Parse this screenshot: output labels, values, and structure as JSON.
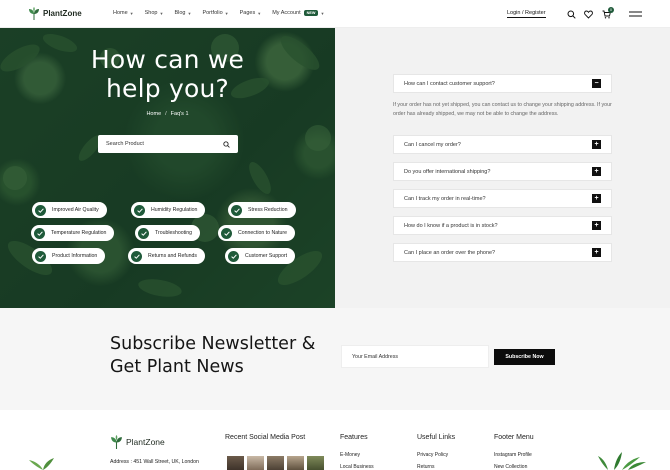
{
  "header": {
    "brand": "PlantZone",
    "nav": [
      {
        "label": "Home"
      },
      {
        "label": "Shop"
      },
      {
        "label": "Blog"
      },
      {
        "label": "Portfolio"
      },
      {
        "label": "Pages"
      },
      {
        "label": "My Account",
        "badge": "NEW"
      }
    ],
    "login_label": "Login / Register",
    "cart_count": "0",
    "icons": [
      "search-icon",
      "heart-icon",
      "cart-icon",
      "menu-icon"
    ]
  },
  "hero": {
    "title_line1": "How can we",
    "title_line2": "help you?",
    "breadcrumb": [
      "Home",
      "Faq's 1"
    ],
    "search_placeholder": "Search Product",
    "tags": [
      "Improved Air Quality",
      "Humidity Regulation",
      "Stress Reduction",
      "Temperature Regulation",
      "Troubleshooting",
      "Connection to Nature",
      "Product Information",
      "Returns and Refunds",
      "Customer Support"
    ]
  },
  "faq": {
    "items": [
      {
        "question": "How can I contact customer support?",
        "toggle": "−",
        "expanded": true
      },
      {
        "question": "Can I cancel my order?",
        "toggle": "+"
      },
      {
        "question": "Do you offer international shipping?",
        "toggle": "+"
      },
      {
        "question": "Can I track my order in real-time?",
        "toggle": "+"
      },
      {
        "question": "How do I know if a product is in stock?",
        "toggle": "+"
      },
      {
        "question": "Can I place an order over the phone?",
        "toggle": "+"
      }
    ],
    "answer": "If your order has not yet shipped, you can contact us to change your shipping address. If your order has already shipped, we may not be able to change the address."
  },
  "newsletter": {
    "title_line1": "Subscribe Newsletter &",
    "title_line2": "Get Plant News",
    "email_placeholder": "Your Email Address",
    "button_label": "Subscribe Now"
  },
  "footer": {
    "brand": "PlantZone",
    "address": "Address : 451 Wall Street, UK, London",
    "columns": [
      {
        "heading": "Recent Social Media Post",
        "links": []
      },
      {
        "heading": "Features",
        "links": [
          "E-Money",
          "Local Business"
        ]
      },
      {
        "heading": "Useful Links",
        "links": [
          "Privacy Policy",
          "Returns"
        ]
      },
      {
        "heading": "Footer Menu",
        "links": [
          "Instagram Profile",
          "New Collection"
        ]
      }
    ]
  },
  "colors": {
    "accent": "#1f5a3a",
    "dark": "#0c0c0c",
    "panel": "#f2f2f2"
  }
}
